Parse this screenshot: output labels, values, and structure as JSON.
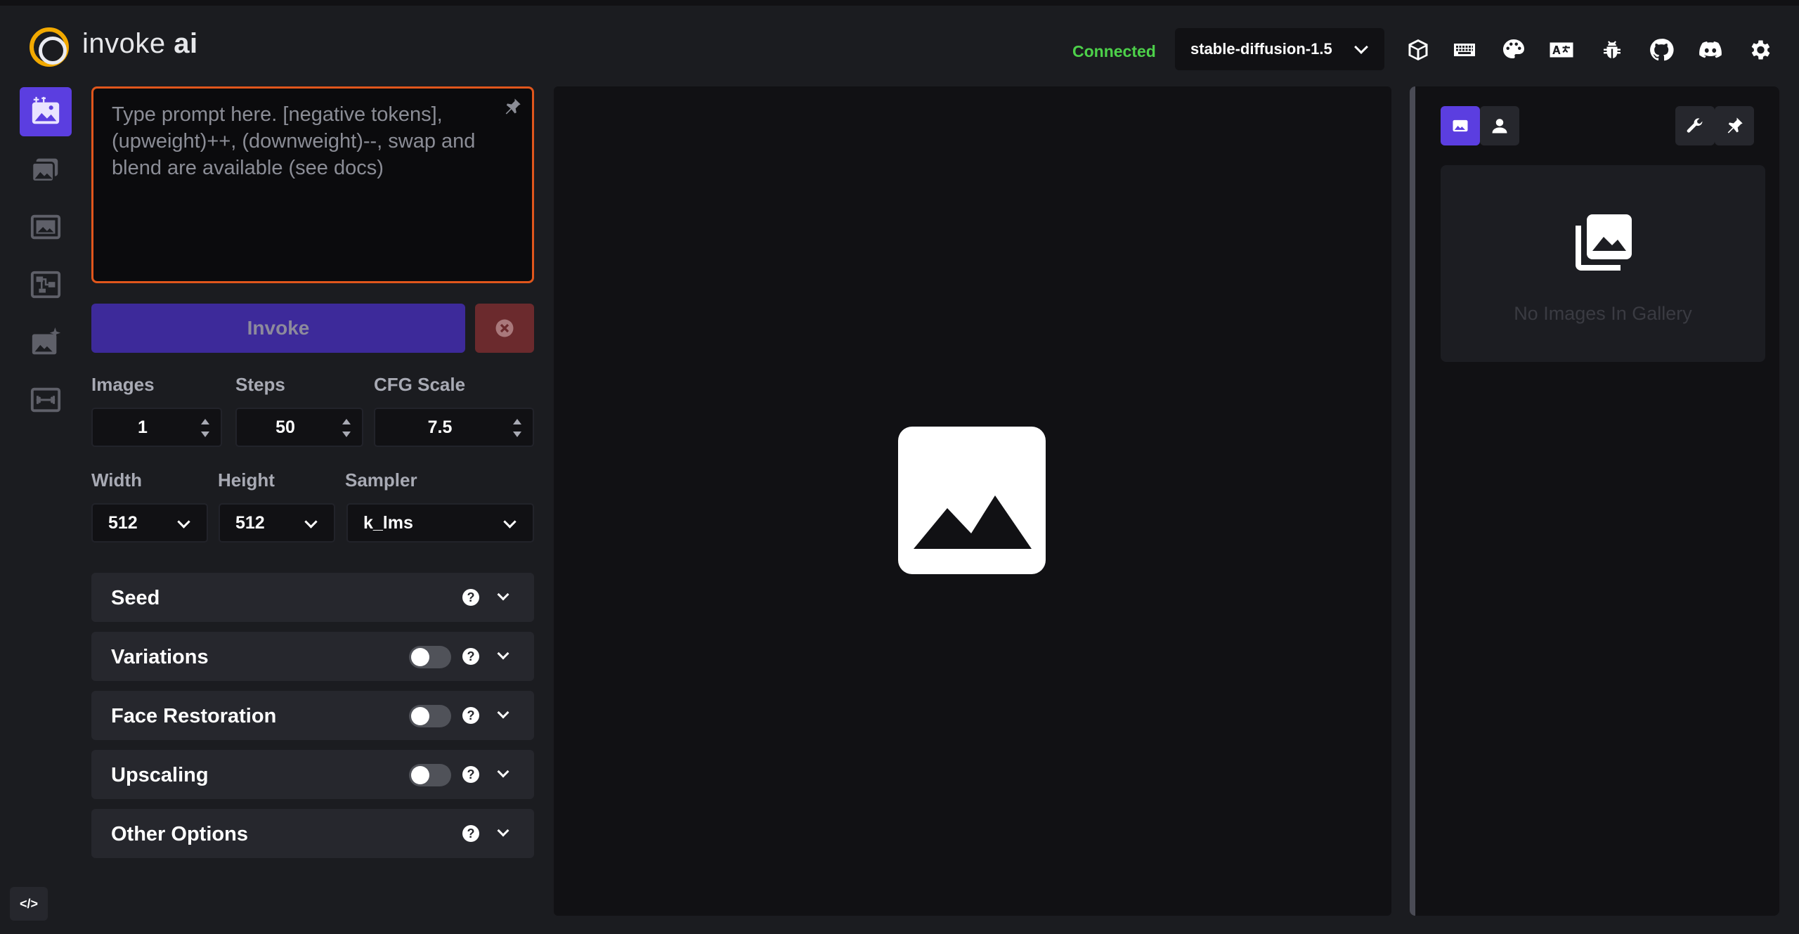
{
  "app": {
    "brand_light": "invoke",
    "brand_bold": "ai"
  },
  "header": {
    "status": "Connected",
    "model": "stable-diffusion-1.5",
    "icons": [
      "cube-icon",
      "keyboard-icon",
      "palette-icon",
      "translate-icon",
      "bug-icon",
      "github-icon",
      "discord-icon",
      "gear-icon"
    ],
    "colors": {
      "connected": "#4dd14a",
      "accent": "#5b3ee0"
    }
  },
  "tabs": [
    "text-to-image",
    "image-to-image",
    "unified-canvas",
    "workflows",
    "training",
    "merge-models"
  ],
  "prompt": {
    "placeholder": "Type prompt here. [negative tokens], (upweight)++, (downweight)--, swap and blend are available (see docs)",
    "value": ""
  },
  "actions": {
    "invoke_label": "Invoke"
  },
  "params": {
    "images_label": "Images",
    "images_value": "1",
    "steps_label": "Steps",
    "steps_value": "50",
    "cfg_label": "CFG Scale",
    "cfg_value": "7.5",
    "width_label": "Width",
    "width_value": "512",
    "height_label": "Height",
    "height_value": "512",
    "sampler_label": "Sampler",
    "sampler_value": "k_lms"
  },
  "accordions": {
    "seed": "Seed",
    "variations": "Variations",
    "face_restoration": "Face Restoration",
    "upscaling": "Upscaling",
    "other_options": "Other Options"
  },
  "gallery": {
    "empty_message": "No Images In Gallery"
  },
  "dev": {
    "label": "</>"
  }
}
